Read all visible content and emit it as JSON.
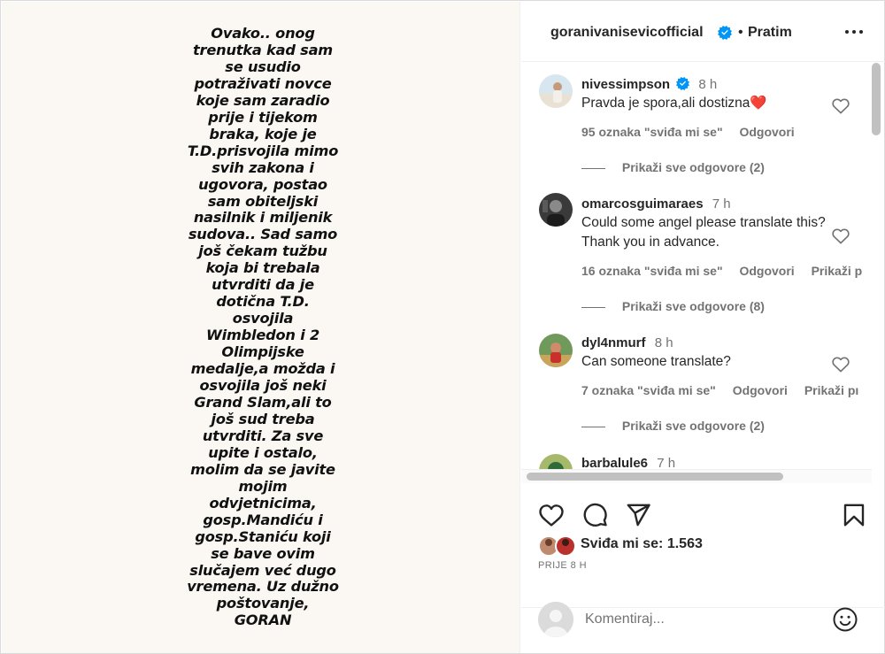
{
  "post": {
    "image_text_lines": [
      "Ovako.. onog",
      "trenutka kad sam",
      "se usudio",
      "potraživati novce",
      "koje sam zaradio",
      "prije i tijekom",
      "braka, koje je",
      "T.D.prisvojila mimo",
      "svih zakona i",
      "ugovora, postao",
      "sam obiteljski",
      "nasilnik i miljenik",
      "sudova.. Sad samo",
      "još čekam tužbu",
      "koja bi trebala",
      "utvrditi da je",
      "dotična T.D.",
      "osvojila",
      "Wimbledon i 2",
      "Olimpijske",
      "medalje,a možda i",
      "osvojila još neki",
      "Grand Slam,ali to",
      "još sud treba",
      "utvrditi. Za sve",
      "upite i ostalo,",
      "molim da se javite",
      "mojim",
      "odvjetnicima,",
      "gosp.Mandiću i",
      "gosp.Staniću koji",
      "se bave ovim",
      "slučajem već dugo",
      "vremena. Uz dužno",
      "poštovanje,",
      "GORAN"
    ]
  },
  "header": {
    "username": "goranivanisevicofficial",
    "separator": "•",
    "follow_label": "Pratim",
    "icons": {
      "verified": "verified-badge-icon",
      "more": "more-options-icon"
    }
  },
  "comments": [
    {
      "username": "nivessimpson",
      "verified": true,
      "time": "8 h",
      "text": "Pravda je spora,ali dostizna❤️",
      "likes": "95 oznaka \"sviđa mi se\"",
      "reply_label": "Odgovori",
      "translate_label": "",
      "view_replies": "Prikaži sve odgovore (2)"
    },
    {
      "username": "omarcosguimaraes",
      "verified": false,
      "time": "7 h",
      "text": "Could some angel please translate this? Thank you in advance.",
      "likes": "16 oznaka \"sviđa mi se\"",
      "reply_label": "Odgovori",
      "translate_label": "Prikaži p",
      "view_replies": "Prikaži sve odgovore (8)"
    },
    {
      "username": "dyl4nmurf",
      "verified": false,
      "time": "8 h",
      "text": "Can someone translate?",
      "likes": "7 oznaka \"sviđa mi se\"",
      "reply_label": "Odgovori",
      "translate_label": "Prikaži pı",
      "view_replies": "Prikaži sve odgovore (2)"
    },
    {
      "username": "barbalule6",
      "verified": false,
      "time": "7 h",
      "text": "",
      "likes": "",
      "reply_label": "",
      "translate_label": "",
      "view_replies": ""
    }
  ],
  "actions": {
    "icons": [
      "heart-icon",
      "comment-icon",
      "share-icon",
      "bookmark-icon"
    ],
    "likes_text": "Sviđa mi se: 1.563",
    "time_ago": "PRIJE 8 H"
  },
  "add_comment": {
    "placeholder": "Komentiraj...",
    "value": "",
    "icon": "emoji-icon"
  },
  "colors": {
    "primary_text": "#262626",
    "secondary_text": "#737373",
    "verified_blue": "#0095f6",
    "border": "#dbdbdb",
    "image_bg": "#fbf8f4"
  }
}
